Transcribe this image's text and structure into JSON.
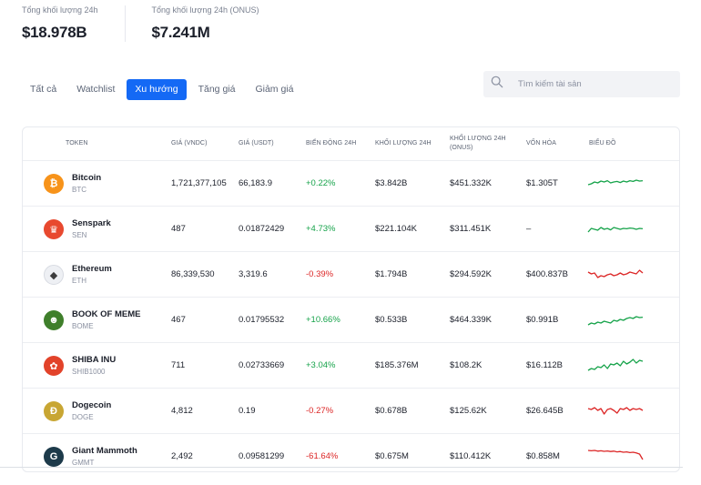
{
  "stats": [
    {
      "label": "Tổng khối lượng 24h",
      "value": "$18.978B"
    },
    {
      "label": "Tổng khối lượng 24h (ONUS)",
      "value": "$7.241M"
    }
  ],
  "tabs": [
    {
      "label": "Tất cả",
      "active": false
    },
    {
      "label": "Watchlist",
      "active": false
    },
    {
      "label": "Xu hướng",
      "active": true
    },
    {
      "label": "Tăng giá",
      "active": false
    },
    {
      "label": "Giảm giá",
      "active": false
    }
  ],
  "search": {
    "placeholder": "Tìm kiếm tài sản",
    "icon": "search-icon"
  },
  "columns": {
    "token": "TOKEN",
    "price_vndc": "GIÁ (VNDC)",
    "price_usdt": "GIÁ (USDT)",
    "change": "BIẾN ĐỘNG 24H",
    "volume": "KHỐI LƯỢNG 24H",
    "volume_onus": "KHỐI LƯỢNG 24H (ONUS)",
    "market_cap": "VỐN HÓA",
    "chart": "BIỂU ĐỒ"
  },
  "colors": {
    "accent": "#1469f5",
    "positive": "#16a34a",
    "negative": "#dc2626"
  },
  "rows": [
    {
      "name": "Bitcoin",
      "symbol": "BTC",
      "icon": "bitcoin-icon",
      "icon_color": "#f7931a",
      "icon_glyph": "₿",
      "price_vndc": "1,721,377,105",
      "price_usdt": "66,183.9",
      "change": "+0.22%",
      "trend": "pos",
      "volume": "$3.842B",
      "volume_onus": "$451.332K",
      "market_cap": "$1.305T",
      "spark": [
        0.4,
        0.45,
        0.55,
        0.5,
        0.6,
        0.55,
        0.62,
        0.5,
        0.55,
        0.58,
        0.52,
        0.6,
        0.55,
        0.62,
        0.58,
        0.65,
        0.6,
        0.62
      ]
    },
    {
      "name": "Senspark",
      "symbol": "SEN",
      "icon": "senspark-icon",
      "icon_color": "#e8492f",
      "icon_glyph": "♛",
      "price_vndc": "487",
      "price_usdt": "0.01872429",
      "change": "+4.73%",
      "trend": "pos",
      "volume": "$221.104K",
      "volume_onus": "$311.451K",
      "market_cap": "–",
      "spark": [
        0.3,
        0.5,
        0.45,
        0.4,
        0.55,
        0.45,
        0.5,
        0.42,
        0.55,
        0.5,
        0.45,
        0.5,
        0.48,
        0.52,
        0.5,
        0.45,
        0.5,
        0.48
      ]
    },
    {
      "name": "Ethereum",
      "symbol": "ETH",
      "icon": "ethereum-icon",
      "icon_color": "#eef0f4",
      "icon_glyph": "◆",
      "price_vndc": "86,339,530",
      "price_usdt": "3,319.6",
      "change": "-0.39%",
      "trend": "neg",
      "volume": "$1.794B",
      "volume_onus": "$294.592K",
      "market_cap": "$400.837B",
      "spark": [
        0.6,
        0.5,
        0.55,
        0.3,
        0.4,
        0.35,
        0.45,
        0.5,
        0.4,
        0.45,
        0.55,
        0.45,
        0.5,
        0.6,
        0.55,
        0.5,
        0.7,
        0.55
      ]
    },
    {
      "name": "BOOK OF MEME",
      "symbol": "BOME",
      "icon": "bome-icon",
      "icon_color": "#3f7f2b",
      "icon_glyph": "☻",
      "price_vndc": "467",
      "price_usdt": "0.01795532",
      "change": "+10.66%",
      "trend": "pos",
      "volume": "$0.533B",
      "volume_onus": "$464.339K",
      "market_cap": "$0.991B",
      "spark": [
        0.2,
        0.3,
        0.25,
        0.35,
        0.3,
        0.4,
        0.35,
        0.3,
        0.45,
        0.4,
        0.5,
        0.45,
        0.55,
        0.6,
        0.55,
        0.65,
        0.6,
        0.62
      ]
    },
    {
      "name": "SHIBA INU",
      "symbol": "SHIB1000",
      "icon": "shiba-icon",
      "icon_color": "#e2432a",
      "icon_glyph": "✿",
      "price_vndc": "711",
      "price_usdt": "0.02733669",
      "change": "+3.04%",
      "trend": "pos",
      "volume": "$185.376M",
      "volume_onus": "$108.2K",
      "market_cap": "$16.112B",
      "spark": [
        0.2,
        0.3,
        0.25,
        0.4,
        0.35,
        0.5,
        0.3,
        0.55,
        0.5,
        0.6,
        0.45,
        0.7,
        0.55,
        0.65,
        0.8,
        0.6,
        0.75,
        0.7
      ]
    },
    {
      "name": "Dogecoin",
      "symbol": "DOGE",
      "icon": "dogecoin-icon",
      "icon_color": "#c8a633",
      "icon_glyph": "Đ",
      "price_vndc": "4,812",
      "price_usdt": "0.19",
      "change": "-0.27%",
      "trend": "neg",
      "volume": "$0.678B",
      "volume_onus": "$125.62K",
      "market_cap": "$26.645B",
      "spark": [
        0.6,
        0.55,
        0.65,
        0.5,
        0.6,
        0.3,
        0.55,
        0.6,
        0.5,
        0.35,
        0.6,
        0.55,
        0.65,
        0.5,
        0.6,
        0.55,
        0.6,
        0.5
      ]
    },
    {
      "name": "Giant Mammoth",
      "symbol": "GMMT",
      "icon": "giant-mammoth-icon",
      "icon_color": "#1d3a4a",
      "icon_glyph": "G",
      "price_vndc": "2,492",
      "price_usdt": "0.09581299",
      "change": "-61.64%",
      "trend": "neg",
      "volume": "$0.675M",
      "volume_onus": "$110.412K",
      "market_cap": "$0.858M",
      "spark": [
        0.8,
        0.78,
        0.8,
        0.76,
        0.78,
        0.75,
        0.77,
        0.74,
        0.76,
        0.72,
        0.74,
        0.7,
        0.72,
        0.68,
        0.7,
        0.66,
        0.6,
        0.3
      ]
    }
  ]
}
